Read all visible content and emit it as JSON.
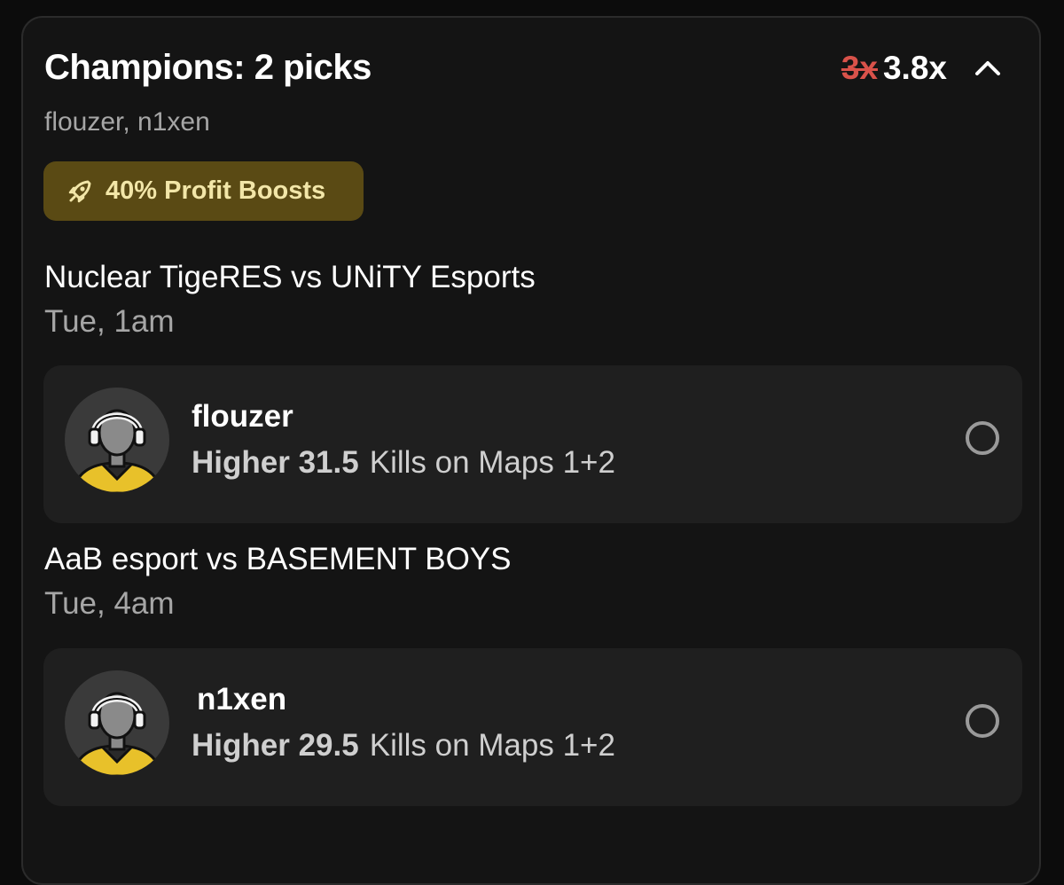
{
  "header": {
    "title": "Champions: 2 picks",
    "multiplier_old": "3x",
    "multiplier_new": "3.8x",
    "collapse_icon": "chevron-up-icon"
  },
  "subtitle": "flouzer, n1xen",
  "boost": {
    "icon": "rocket-icon",
    "label": "40% Profit Boosts",
    "bg_color": "#5a4a14",
    "text_color": "#f2e6a8"
  },
  "picks": [
    {
      "match": "Nuclear TigeRES vs UNiTY Esports",
      "time": "Tue, 1am",
      "player": "flouzer",
      "direction": "Higher",
      "line": "31.5",
      "stat": "Kills on Maps 1+2",
      "avatar_icon": "player-avatar-icon"
    },
    {
      "match": "AaB esport vs BASEMENT BOYS",
      "time": "Tue, 4am",
      "player": "n1xen",
      "direction": "Higher",
      "line": "29.5",
      "stat": "Kills on Maps 1+2",
      "avatar_icon": "player-avatar-icon"
    }
  ],
  "colors": {
    "strike_red": "#d9524a",
    "jersey_yellow": "#e8c12a"
  }
}
